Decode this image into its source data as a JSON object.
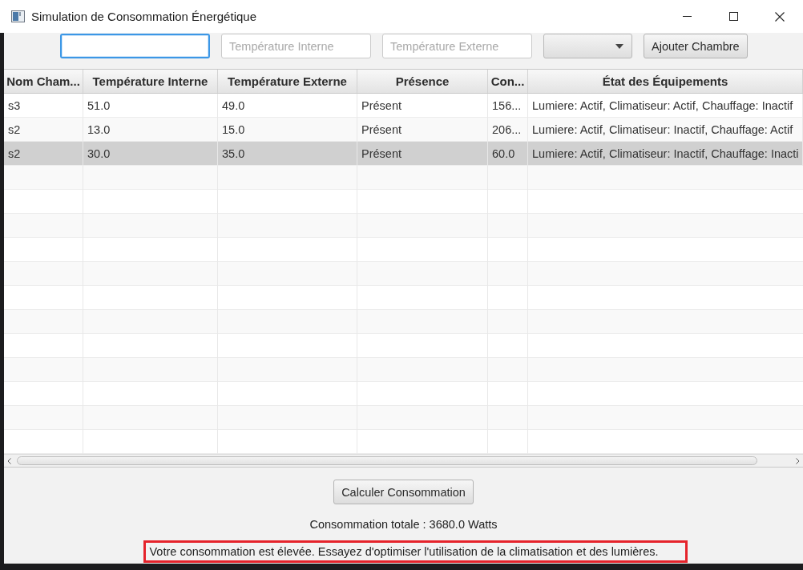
{
  "window": {
    "title": "Simulation de Consommation Énergétique"
  },
  "form": {
    "fields": [
      {
        "kind": "text",
        "focused": true
      },
      {
        "kind": "text",
        "placeholder": "Température Interne",
        "focused": false
      },
      {
        "kind": "text",
        "placeholder": "Température Externe",
        "focused": false
      },
      {
        "kind": "combo",
        "focused": false
      }
    ],
    "button": "Ajouter Chambre"
  },
  "table": {
    "columns": [
      "Nom Cham...",
      "Température Interne",
      "Température Externe",
      "Présence",
      "Con...",
      "État des Équipements"
    ],
    "rows": [
      {
        "cells": [
          "s3",
          "51.0",
          "49.0",
          "Présent",
          "156...",
          "Lumiere: Actif, Climatiseur: Actif, Chauffage: Inactif"
        ],
        "selected": false
      },
      {
        "cells": [
          "s2",
          "13.0",
          "15.0",
          "Présent",
          "206...",
          "Lumiere: Actif, Climatiseur: Inactif, Chauffage: Actif"
        ],
        "selected": false
      },
      {
        "cells": [
          "s2",
          "30.0",
          "35.0",
          "Présent",
          "60.0",
          "Lumiere: Actif, Climatiseur: Inactif, Chauffage: Inacti"
        ],
        "selected": true
      }
    ]
  },
  "footer": {
    "button": "Calculer Consommation",
    "total": "Consommation totale : 3680.0 Watts",
    "message": {
      "text": "Votre consommation est élevée. Essayez d'optimiser l'utilisation de la climatisation et des lumières.",
      "highlighted": true
    }
  }
}
